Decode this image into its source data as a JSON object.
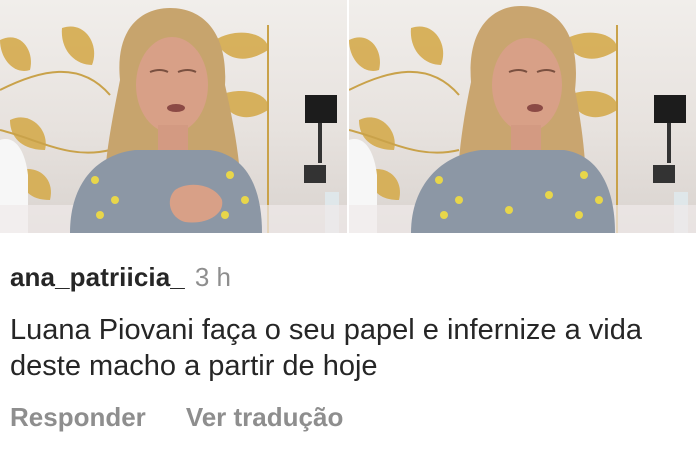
{
  "photos": [
    {
      "icon": "video-frame-left"
    },
    {
      "icon": "video-frame-right"
    }
  ],
  "comment": {
    "username": "ana_patriicia_",
    "time": "3 h",
    "text": "Luana Piovani faça o seu papel e infernize a vida deste macho a partir de hoje"
  },
  "actions": {
    "reply": "Responder",
    "translate": "Ver tradução"
  },
  "colors": {
    "primary_text": "#262626",
    "secondary_text": "#8e8e8e",
    "background": "#ffffff"
  }
}
